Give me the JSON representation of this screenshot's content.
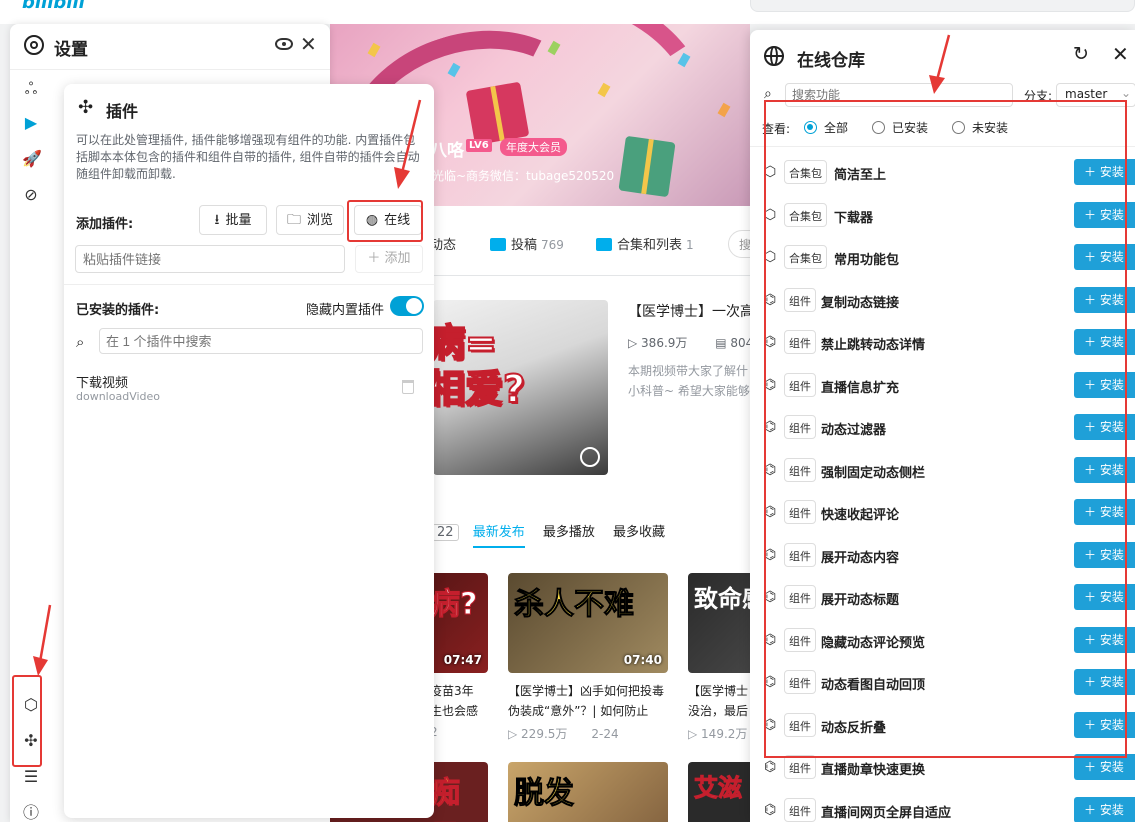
{
  "background": {
    "logo": "bilibili",
    "up_name": "八咯",
    "level_badge": "LV6",
    "vip_badge": "年度大会员",
    "up_sign": "光临~商务微信：tubage520520",
    "nav": [
      {
        "label": "动态",
        "count": ""
      },
      {
        "label": "投稿",
        "count": "769"
      },
      {
        "label": "合集和列表",
        "count": "1"
      }
    ],
    "search_stub": "搜",
    "feature": {
      "thumb_text": "病=\n相爱?",
      "title": "【医学博士】一次高",
      "plays": "386.9万",
      "danmaku": "804",
      "desc_line1": "本期视频带大家了解什",
      "desc_line2": "小科普~ 希望大家能够"
    },
    "sort": {
      "count": "22",
      "tabs": [
        "最新发布",
        "最多播放",
        "最多收藏"
      ]
    },
    "videos": [
      {
        "thumb": "病?",
        "duration": "07:47",
        "title_line1": "疫苗3年",
        "title_line2": "生也会感",
        "meta": "2"
      },
      {
        "thumb": "杀人不难",
        "duration": "07:40",
        "title_line1": "【医学博士】凶手如何把投毒",
        "title_line2": "伪装成“意外”？| 如何防止",
        "meta": "229.5万",
        "date": "2-24"
      },
      {
        "thumb": "致命感",
        "duration": "",
        "title_line1": "【医学博士",
        "title_line2": "没治，最后",
        "meta": "149.2万"
      },
      {
        "thumb": "痴呆",
        "duration": "",
        "title_line1": "",
        "title_line2": "",
        "meta": ""
      },
      {
        "thumb": "脱发",
        "duration": "",
        "title_line1": "",
        "title_line2": "",
        "meta": ""
      },
      {
        "thumb": "艾滋",
        "duration": "",
        "title_line1": "",
        "title_line2": "",
        "meta": ""
      }
    ]
  },
  "settings": {
    "title": "设置",
    "plugin_panel": {
      "title": "插件",
      "description": "可以在此处管理插件, 插件能够增强现有组件的功能. 内置插件包括脚本本体包含的插件和组件自带的插件, 组件自带的插件会自动随组件卸载而卸载.",
      "add_label": "添加插件:",
      "batch_label": "批量",
      "browse_label": "浏览",
      "online_label": "在线",
      "link_placeholder": "粘贴插件链接",
      "add_button": "＋ 添加",
      "installed_label": "已安装的插件:",
      "hide_builtin_label": "隐藏内置插件",
      "hide_builtin_on": true,
      "search_placeholder": "在 1 个插件中搜索",
      "installed": [
        {
          "name": "下载视频",
          "id": "downloadVideo"
        }
      ]
    }
  },
  "repo": {
    "title": "在线仓库",
    "search_placeholder": "搜索功能",
    "branch_label": "分支:",
    "branch_value": "master",
    "filter_label": "查看:",
    "filters": [
      {
        "label": "全部",
        "checked": true
      },
      {
        "label": "已安装",
        "checked": false
      },
      {
        "label": "未安装",
        "checked": false
      }
    ],
    "install_label": "＋ 安装",
    "items": [
      {
        "tag": "合集包",
        "name": "简洁至上",
        "icon": "package-icon"
      },
      {
        "tag": "合集包",
        "name": "下载器",
        "icon": "package-icon"
      },
      {
        "tag": "合集包",
        "name": "常用功能包",
        "icon": "package-icon"
      },
      {
        "tag": "组件",
        "name": "复制动态链接",
        "icon": "component-icon"
      },
      {
        "tag": "组件",
        "name": "禁止跳转动态详情",
        "icon": "component-icon"
      },
      {
        "tag": "组件",
        "name": "直播信息扩充",
        "icon": "component-icon"
      },
      {
        "tag": "组件",
        "name": "动态过滤器",
        "icon": "component-icon"
      },
      {
        "tag": "组件",
        "name": "强制固定动态侧栏",
        "icon": "component-icon"
      },
      {
        "tag": "组件",
        "name": "快速收起评论",
        "icon": "component-icon"
      },
      {
        "tag": "组件",
        "name": "展开动态内容",
        "icon": "component-icon"
      },
      {
        "tag": "组件",
        "name": "展开动态标题",
        "icon": "component-icon"
      },
      {
        "tag": "组件",
        "name": "隐藏动态评论预览",
        "icon": "component-icon"
      },
      {
        "tag": "组件",
        "name": "动态看图自动回顶",
        "icon": "component-icon"
      },
      {
        "tag": "组件",
        "name": "动态反折叠",
        "icon": "component-icon"
      },
      {
        "tag": "组件",
        "name": "直播勋章快速更换",
        "icon": "component-icon"
      },
      {
        "tag": "组件",
        "name": "直播间网页全屏自适应",
        "icon": "component-icon"
      }
    ]
  },
  "colors": {
    "accent": "#00a1d6",
    "install": "#1fa0d8",
    "highlight": "#e53935"
  }
}
